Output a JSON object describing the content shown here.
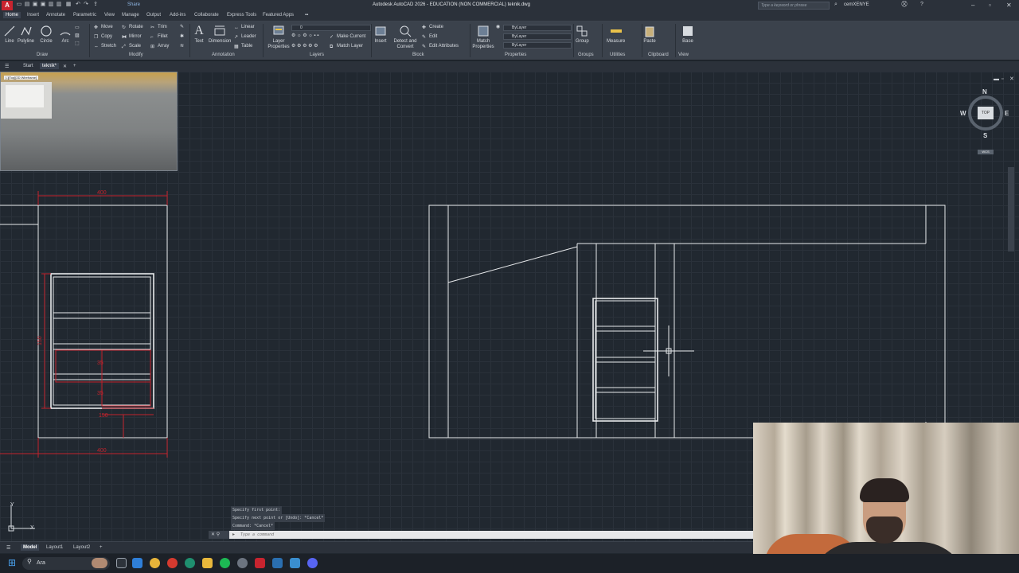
{
  "titlebar": {
    "app_letter": "A",
    "share": "Share",
    "title": "Autodesk AutoCAD 2026 - EDUCATION (NON COMMERCIAL)   teknik.dwg",
    "search_placeholder": "Type a keyword or phrase",
    "user": "cemXENYE"
  },
  "ribbon_tabs": [
    "Home",
    "Insert",
    "Annotate",
    "Parametric",
    "View",
    "Manage",
    "Output",
    "Add-ins",
    "Collaborate",
    "Express Tools",
    "Featured Apps"
  ],
  "ribbon": {
    "draw": {
      "title": "Draw",
      "tools": [
        "Line",
        "Polyline",
        "Circle",
        "Arc"
      ]
    },
    "modify": {
      "title": "Modify",
      "tools": [
        "Move",
        "Rotate",
        "Trim",
        "Copy",
        "Mirror",
        "Fillet",
        "Stretch",
        "Scale",
        "Array"
      ]
    },
    "annotation": {
      "title": "Annotation",
      "text": "Text",
      "dimension": "Dimension",
      "linear": "Linear",
      "leader": "Leader",
      "table": "Table"
    },
    "layers": {
      "title": "Layers",
      "layer_properties": "Layer Properties",
      "make_current": "Make Current",
      "match_layer": "Match Layer",
      "current_layer": "0"
    },
    "block": {
      "title": "Block",
      "insert": "Insert",
      "detect": "Detect and Convert",
      "create": "Create",
      "edit": "Edit",
      "edit_attributes": "Edit Attributes"
    },
    "properties": {
      "title": "Properties",
      "match": "Match Properties",
      "color": "ByLayer",
      "linetype": "ByLayer",
      "lineweight": "ByLayer"
    },
    "groups": {
      "title": "Groups",
      "group": "Group"
    },
    "utilities": {
      "title": "Utilities",
      "measure": "Measure"
    },
    "clipboard": {
      "title": "Clipboard",
      "paste": "Paste"
    },
    "view": {
      "title": "View",
      "base": "Base"
    }
  },
  "file_tabs": [
    "Start",
    "teknik*"
  ],
  "viewcube": {
    "n": "N",
    "s": "S",
    "e": "E",
    "w": "W",
    "top": "TOP",
    "wcs": "WCS"
  },
  "thumbnail": {
    "tag": "[-][Top][2D Wireframe]"
  },
  "dimensions": {
    "top": "400",
    "side": "150",
    "bottom": "400",
    "inner_a": "35",
    "inner_b": "35",
    "inner_c": "150"
  },
  "command": {
    "history": [
      "Specify first point:",
      "Specify next point or [Undo]: *Cancel*",
      "Command: *Cancel*"
    ],
    "placeholder": "Type a command"
  },
  "layout_tabs": [
    "Model",
    "Layout1",
    "Layout2"
  ],
  "taskbar": {
    "search": "Ara"
  },
  "colors": {
    "accent_red": "#c8242f",
    "dim_red": "#c4222c",
    "line_white": "#e8eaec",
    "canvas": "#212830"
  }
}
